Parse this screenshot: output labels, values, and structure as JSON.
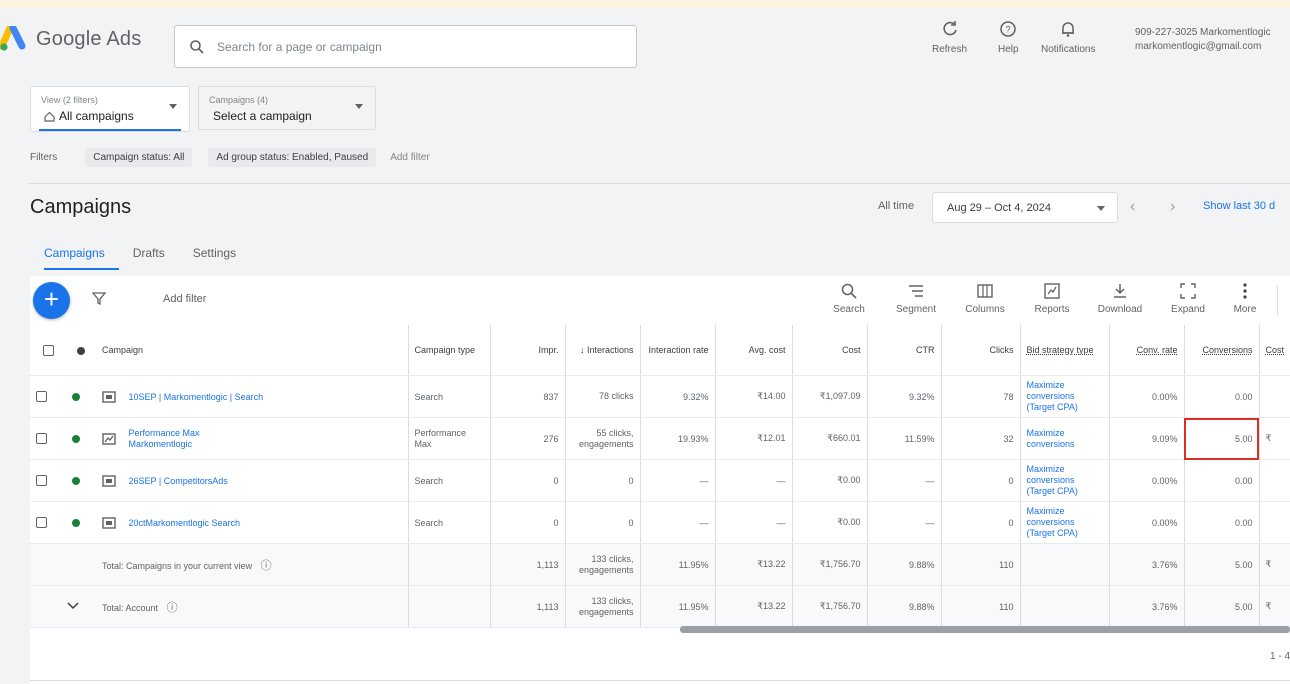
{
  "header": {
    "app_name": "Google Ads",
    "search_placeholder": "Search for a page or campaign",
    "refresh_label": "Refresh",
    "help_label": "Help",
    "notifications_label": "Notifications",
    "account_line1": "909-227-3025 Markomentlogic",
    "account_line2": "markomentlogic@gmail.com"
  },
  "views": {
    "view_label": "View (2 filters)",
    "view_value": "All campaigns",
    "campaigns_label": "Campaigns (4)",
    "campaigns_value": "Select a campaign"
  },
  "filters": {
    "label": "Filters",
    "chips": [
      "Campaign status: All",
      "Ad group status: Enabled, Paused"
    ],
    "add_filter": "Add filter"
  },
  "page": {
    "title": "Campaigns",
    "all_time": "All time",
    "date_range": "Aug 29 – Oct 4, 2024",
    "show_last": "Show last 30 d",
    "tabs": [
      "Campaigns",
      "Drafts",
      "Settings"
    ]
  },
  "toolbar": {
    "add_filter": "Add filter",
    "search": "Search",
    "segment": "Segment",
    "columns": "Columns",
    "reports": "Reports",
    "download": "Download",
    "expand": "Expand",
    "more": "More"
  },
  "table": {
    "headers": {
      "campaign": "Campaign",
      "campaign_type": "Campaign type",
      "impr": "Impr.",
      "interactions": "Interactions",
      "interaction_rate": "Interaction rate",
      "avg_cost": "Avg. cost",
      "cost": "Cost",
      "ctr": "CTR",
      "clicks": "Clicks",
      "bid_strategy_type": "Bid strategy type",
      "conv_rate": "Conv. rate",
      "conversions": "Conversions",
      "cost_per_conv": "Cost"
    },
    "rows": [
      {
        "name": "10SEP | Markomentlogic | Search",
        "type": "Search",
        "impr": "837",
        "interactions": "78 clicks",
        "interaction_rate": "9.32%",
        "avg_cost": "₹14.00",
        "cost": "₹1,097.09",
        "ctr": "9.32%",
        "clicks": "78",
        "bid": "Maximize conversions (Target CPA)",
        "conv_rate": "0.00%",
        "conversions": "0.00",
        "cost_per_conv": "",
        "status_color": "#188038"
      },
      {
        "name": "Performance Max Markomentlogic",
        "type": "Performance Max",
        "impr": "276",
        "interactions": "55 clicks, engagements",
        "interaction_rate": "19.93%",
        "avg_cost": "₹12.01",
        "cost": "₹660.01",
        "ctr": "11.59%",
        "clicks": "32",
        "bid": "Maximize conversions",
        "conv_rate": "9.09%",
        "conversions": "5.00",
        "cost_per_conv": "₹",
        "status_color": "#188038"
      },
      {
        "name": "26SEP | CompetitorsAds",
        "type": "Search",
        "impr": "0",
        "interactions": "0",
        "interaction_rate": "—",
        "avg_cost": "—",
        "cost": "₹0.00",
        "ctr": "—",
        "clicks": "0",
        "bid": "Maximize conversions (Target CPA)",
        "conv_rate": "0.00%",
        "conversions": "0.00",
        "cost_per_conv": "",
        "status_color": "#188038"
      },
      {
        "name": "20ctMarkomentlogic Search",
        "type": "Search",
        "impr": "0",
        "interactions": "0",
        "interaction_rate": "—",
        "avg_cost": "—",
        "cost": "₹0.00",
        "ctr": "—",
        "clicks": "0",
        "bid": "Maximize conversions (Target CPA)",
        "conv_rate": "0.00%",
        "conversions": "0.00",
        "cost_per_conv": "",
        "status_color": "#188038"
      }
    ],
    "totals": [
      {
        "label": "Total: Campaigns in your current view",
        "impr": "1,113",
        "interactions": "133 clicks, engagements",
        "interaction_rate": "11.95%",
        "avg_cost": "₹13.22",
        "cost": "₹1,756.70",
        "ctr": "9.88%",
        "clicks": "110",
        "conv_rate": "3.76%",
        "conversions": "5.00",
        "cost_per_conv": "₹"
      },
      {
        "label": "Total: Account",
        "impr": "1,113",
        "interactions": "133 clicks, engagements",
        "interaction_rate": "11.95%",
        "avg_cost": "₹13.22",
        "cost": "₹1,756.70",
        "ctr": "9.88%",
        "clicks": "110",
        "conv_rate": "3.76%",
        "conversions": "5.00",
        "cost_per_conv": "₹"
      }
    ],
    "pagination": "1 - 4"
  },
  "colors": {
    "accent": "#1a73e8",
    "enabled": "#188038",
    "highlight": "#d93025"
  }
}
